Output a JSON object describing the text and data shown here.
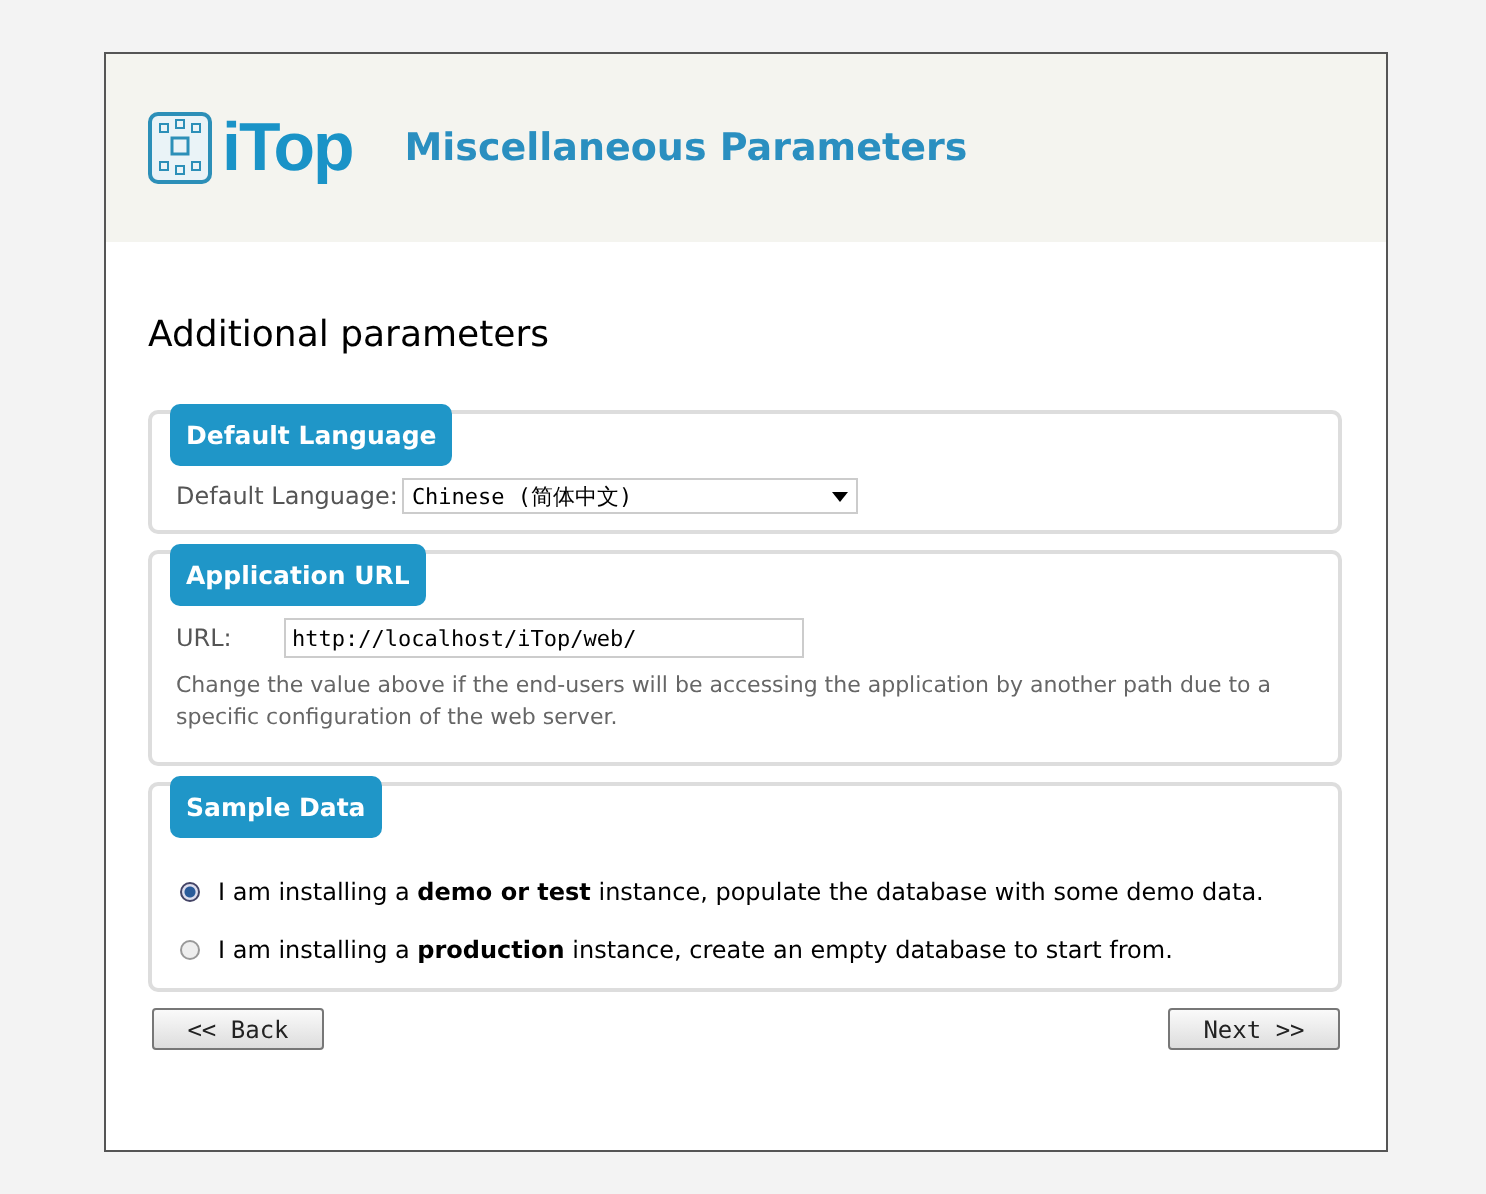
{
  "header": {
    "logo": "iTop",
    "title": "Miscellaneous Parameters"
  },
  "heading": "Additional parameters",
  "language": {
    "legend": "Default Language",
    "label": "Default Language:",
    "value": "Chinese (简体中文)"
  },
  "url": {
    "legend": "Application URL",
    "label": "URL:",
    "value": "http://localhost/iTop/web/",
    "help": "Change the value above if the end-users will be accessing the application by another path due to a specific configuration of the web server."
  },
  "sample": {
    "legend": "Sample Data",
    "options": [
      {
        "label": "I am installing a **demo or test** instance, populate the database with some demo data.",
        "selected": true
      },
      {
        "label": "I am installing a **production** instance, create an empty database to start from.",
        "selected": false
      }
    ]
  },
  "buttons": {
    "back": "<< Back",
    "next": "Next >>"
  }
}
